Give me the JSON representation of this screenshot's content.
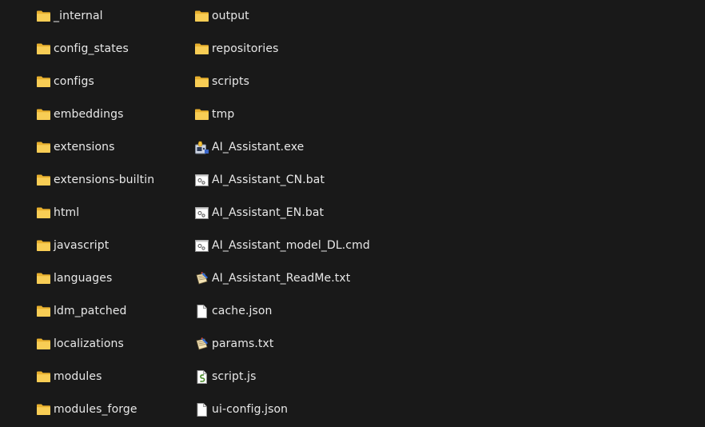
{
  "left_column": [
    {
      "name": "_internal",
      "icon": "folder-icon"
    },
    {
      "name": "config_states",
      "icon": "folder-icon"
    },
    {
      "name": "configs",
      "icon": "folder-icon"
    },
    {
      "name": "embeddings",
      "icon": "folder-icon"
    },
    {
      "name": "extensions",
      "icon": "folder-icon"
    },
    {
      "name": "extensions-builtin",
      "icon": "folder-icon"
    },
    {
      "name": "html",
      "icon": "folder-icon"
    },
    {
      "name": "javascript",
      "icon": "folder-icon"
    },
    {
      "name": "languages",
      "icon": "folder-icon"
    },
    {
      "name": "ldm_patched",
      "icon": "folder-icon"
    },
    {
      "name": "localizations",
      "icon": "folder-icon"
    },
    {
      "name": "modules",
      "icon": "folder-icon"
    },
    {
      "name": "modules_forge",
      "icon": "folder-icon"
    }
  ],
  "right_column": [
    {
      "name": "output",
      "icon": "folder-icon"
    },
    {
      "name": "repositories",
      "icon": "folder-icon"
    },
    {
      "name": "scripts",
      "icon": "folder-icon"
    },
    {
      "name": "tmp",
      "icon": "folder-icon"
    },
    {
      "name": "AI_Assistant.exe",
      "icon": "exe-icon"
    },
    {
      "name": "AI_Assistant_CN.bat",
      "icon": "batch-file-icon"
    },
    {
      "name": "AI_Assistant_EN.bat",
      "icon": "batch-file-icon"
    },
    {
      "name": "AI_Assistant_model_DL.cmd",
      "icon": "batch-file-icon"
    },
    {
      "name": "AI_Assistant_ReadMe.txt",
      "icon": "text-file-icon"
    },
    {
      "name": "cache.json",
      "icon": "blank-file-icon"
    },
    {
      "name": "params.txt",
      "icon": "text-file-icon"
    },
    {
      "name": "script.js",
      "icon": "script-file-icon"
    },
    {
      "name": "ui-config.json",
      "icon": "blank-file-icon"
    }
  ],
  "colors": {
    "background": "#191919",
    "text": "#e8e8e8",
    "folder": "#f4c64c"
  }
}
